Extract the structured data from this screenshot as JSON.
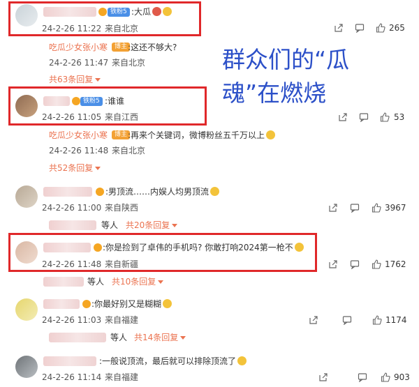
{
  "overlay": {
    "line1": "群众们的“瓜",
    "line2": "魂”在燃烧"
  },
  "comments": [
    {
      "text": ":大瓜",
      "tag": "铁粉5",
      "time": "24-2-26 11:22",
      "location": "来自北京",
      "likes": "265",
      "reply": {
        "author": "吃瓜少女张小寒",
        "author_tag": "博主",
        "text": ":这还不够大?",
        "time": "24-2-26 11:47",
        "location": "来自北京"
      },
      "more": "共63条回复"
    },
    {
      "text": ":谁谁",
      "tag": "铁粉5",
      "time": "24-2-26 11:05",
      "location": "来自江西",
      "likes": "53",
      "reply": {
        "author": "吃瓜少女张小寒",
        "author_tag": "博主",
        "text": ":再来个关键词，微博粉丝五千万以上",
        "time": "24-2-26 11:48",
        "location": "来自北京"
      },
      "more": "共52条回复"
    },
    {
      "text": ":男顶流……内娱人均男顶流",
      "time": "24-2-26 11:00",
      "location": "来自陕西",
      "likes": "3967",
      "reply_author_suffix": "等人",
      "more": "共20条回复"
    },
    {
      "text": ":你是捡到了卓伟的手机吗? 你敢打响2024第一枪不",
      "time": "24-2-26 11:48",
      "location": "来自新疆",
      "likes": "1762",
      "reply_author_suffix": "等人",
      "more": "共10条回复"
    },
    {
      "text": ":你最好别又是糊糊",
      "time": "24-2-26 11:03",
      "location": "来自福建",
      "likes": "1174",
      "reply_author_suffix": "等人",
      "more": "共14条回复"
    },
    {
      "text": ":一般说顶流，最后就可以排除顶流了",
      "time": "24-2-26 11:14",
      "location": "来自福建",
      "likes": "903"
    }
  ],
  "icons": {
    "share": "share-icon",
    "comment": "comment-icon",
    "like": "like-icon"
  },
  "colors": {
    "highlight": "#e0282a",
    "overlay_text": "#2c50c8",
    "link": "#eb7350"
  }
}
